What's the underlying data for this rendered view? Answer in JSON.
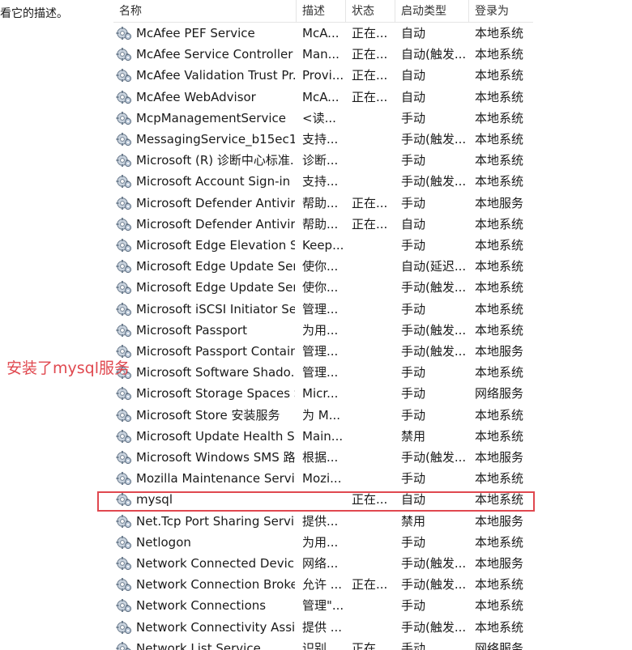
{
  "left_text": "看它的描述。",
  "columns": {
    "name": "名称",
    "description": "描述",
    "status": "状态",
    "startup_type": "启动类型",
    "logon_as": "登录为",
    "sort_indicator": "^"
  },
  "annotation": "安装了mysql服务",
  "highlight_color": "#e0484f",
  "services": [
    {
      "name": "McAfee PEF Service",
      "desc": "McA...",
      "status": "正在...",
      "startup": "自动",
      "logon": "本地系统"
    },
    {
      "name": "McAfee Service Controller",
      "desc": "Man...",
      "status": "正在...",
      "startup": "自动(触发...",
      "logon": "本地系统"
    },
    {
      "name": "McAfee Validation Trust Pr...",
      "desc": "Provi...",
      "status": "正在...",
      "startup": "自动",
      "logon": "本地系统"
    },
    {
      "name": "McAfee WebAdvisor",
      "desc": "McA...",
      "status": "正在...",
      "startup": "自动",
      "logon": "本地系统"
    },
    {
      "name": "McpManagementService",
      "desc": "<读...",
      "status": "",
      "startup": "手动",
      "logon": "本地系统"
    },
    {
      "name": "MessagingService_b15ec1",
      "desc": "支持...",
      "status": "",
      "startup": "手动(触发...",
      "logon": "本地系统"
    },
    {
      "name": "Microsoft (R) 诊断中心标准...",
      "desc": "诊断...",
      "status": "",
      "startup": "手动",
      "logon": "本地系统"
    },
    {
      "name": "Microsoft Account Sign-in ...",
      "desc": "支持...",
      "status": "",
      "startup": "手动(触发...",
      "logon": "本地系统"
    },
    {
      "name": "Microsoft Defender Antivir...",
      "desc": "帮助...",
      "status": "正在...",
      "startup": "手动",
      "logon": "本地服务"
    },
    {
      "name": "Microsoft Defender Antivir...",
      "desc": "帮助...",
      "status": "正在...",
      "startup": "自动",
      "logon": "本地系统"
    },
    {
      "name": "Microsoft Edge Elevation S...",
      "desc": "Keep...",
      "status": "",
      "startup": "手动",
      "logon": "本地系统"
    },
    {
      "name": "Microsoft Edge Update Ser...",
      "desc": "使你...",
      "status": "",
      "startup": "自动(延迟...",
      "logon": "本地系统"
    },
    {
      "name": "Microsoft Edge Update Ser...",
      "desc": "使你...",
      "status": "",
      "startup": "手动(触发...",
      "logon": "本地系统"
    },
    {
      "name": "Microsoft iSCSI Initiator Ser...",
      "desc": "管理...",
      "status": "",
      "startup": "手动",
      "logon": "本地系统"
    },
    {
      "name": "Microsoft Passport",
      "desc": "为用...",
      "status": "",
      "startup": "手动(触发...",
      "logon": "本地系统"
    },
    {
      "name": "Microsoft Passport Container",
      "desc": "管理...",
      "status": "",
      "startup": "手动(触发...",
      "logon": "本地服务"
    },
    {
      "name": "Microsoft Software Shado...",
      "desc": "管理...",
      "status": "",
      "startup": "手动",
      "logon": "本地系统"
    },
    {
      "name": "Microsoft Storage Spaces S...",
      "desc": "Micr...",
      "status": "",
      "startup": "手动",
      "logon": "网络服务"
    },
    {
      "name": "Microsoft Store 安装服务",
      "desc": "为 M...",
      "status": "",
      "startup": "手动",
      "logon": "本地系统"
    },
    {
      "name": "Microsoft Update Health S...",
      "desc": "Main...",
      "status": "",
      "startup": "禁用",
      "logon": "本地系统"
    },
    {
      "name": "Microsoft Windows SMS 路...",
      "desc": "根据...",
      "status": "",
      "startup": "手动(触发...",
      "logon": "本地服务"
    },
    {
      "name": "Mozilla Maintenance Service",
      "desc": "Mozi...",
      "status": "",
      "startup": "手动",
      "logon": "本地系统"
    },
    {
      "name": "mysql",
      "desc": "",
      "status": "正在...",
      "startup": "自动",
      "logon": "本地系统",
      "highlighted": true
    },
    {
      "name": "Net.Tcp Port Sharing Service",
      "desc": "提供...",
      "status": "",
      "startup": "禁用",
      "logon": "本地服务"
    },
    {
      "name": "Netlogon",
      "desc": "为用...",
      "status": "",
      "startup": "手动",
      "logon": "本地系统"
    },
    {
      "name": "Network Connected Devic...",
      "desc": "网络...",
      "status": "",
      "startup": "手动(触发...",
      "logon": "本地服务"
    },
    {
      "name": "Network Connection Broker",
      "desc": "允许 ...",
      "status": "正在...",
      "startup": "手动(触发...",
      "logon": "本地系统"
    },
    {
      "name": "Network Connections",
      "desc": "管理\"...",
      "status": "",
      "startup": "手动",
      "logon": "本地系统"
    },
    {
      "name": "Network Connectivity Assis...",
      "desc": "提供 ...",
      "status": "",
      "startup": "手动(触发...",
      "logon": "本地系统"
    },
    {
      "name": "Network List Service",
      "desc": "识别...",
      "status": "正在...",
      "startup": "手动",
      "logon": "网络服务"
    }
  ]
}
